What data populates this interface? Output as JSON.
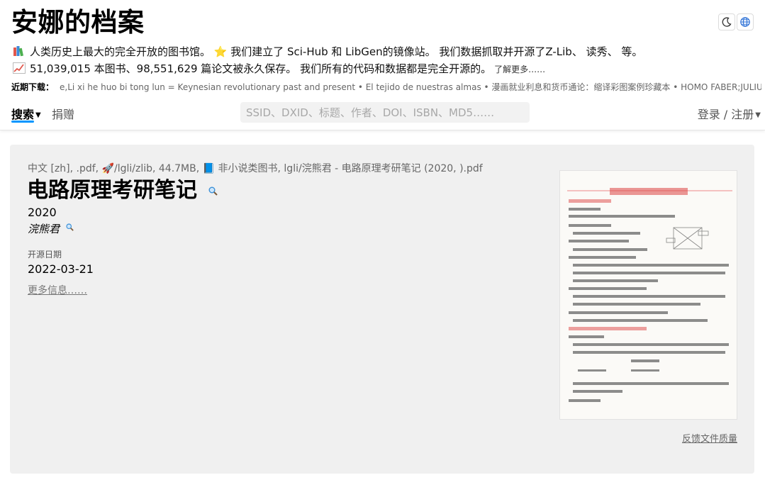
{
  "site": {
    "title": "安娜的档案"
  },
  "header": {
    "tagline": "人类历史上最大的完全开放的图书馆。 ⭐ 我们建立了 Sci-Hub 和 LibGen的镜像站。 我们数据抓取并开源了Z-Lib、 读秀、 等。",
    "stats": "51,039,015 本图书、98,551,629 篇论文被永久保存。 我们所有的代码和数据都是完全开源的。",
    "learn_more": "了解更多……",
    "recent_label": "近期下载：",
    "recent_items": "e,Li xi he huo bi tong lun = Keynesian revolutionary past and present • El tejido de nuestras almas • 漫画就业利息和货币通论：缩译彩图案例珍藏本 • HOMO FABER;JULIUS"
  },
  "nav": {
    "search_label": "搜索",
    "donate_label": "捐赠",
    "search_placeholder": "SSID、DXID、标题、作者、DOI、ISBN、MD5……",
    "login_label": "登录 / 注册"
  },
  "book": {
    "meta": "中文 [zh], .pdf, 🚀/lgli/zlib, 44.7MB, 📘 非小说类图书, lgli/浣熊君 - 电路原理考研笔记 (2020, ).pdf",
    "title": "电路原理考研笔记",
    "year": "2020",
    "author": "浣熊君",
    "open_source_label": "开源日期",
    "open_source_date": "2022-03-21",
    "more_info": "更多信息……",
    "feedback": "反馈文件质量"
  },
  "colors": {
    "accent": "#0095ff",
    "card_bg": "#f0f0f0"
  },
  "icons": {
    "theme": "moon-icon",
    "language": "globe-icon",
    "search_inline": "magnifier-icon"
  }
}
